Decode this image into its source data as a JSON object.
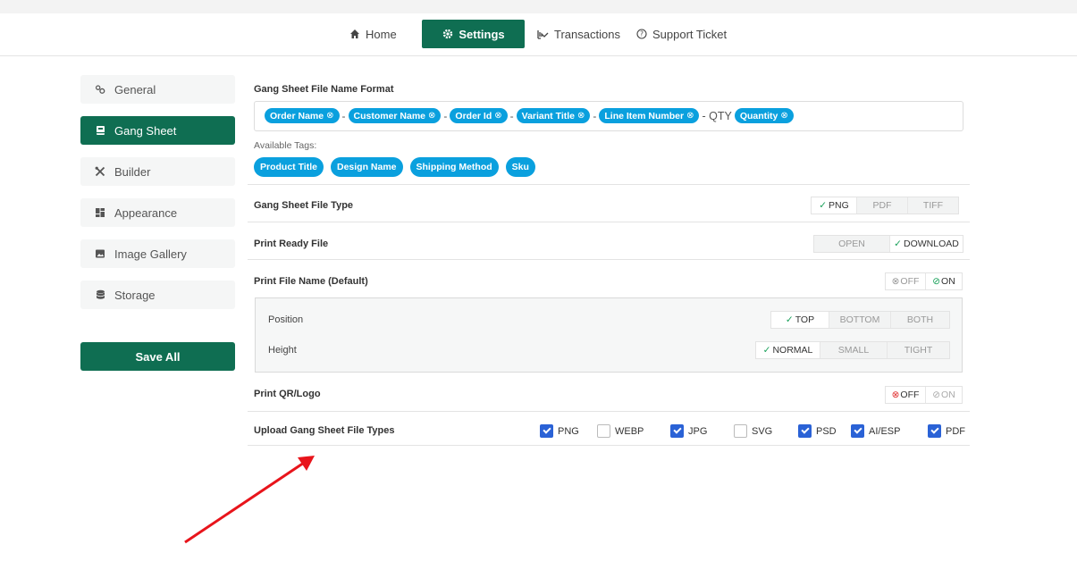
{
  "nav": {
    "home": "Home",
    "settings": "Settings",
    "transactions": "Transactions",
    "support": "Support Ticket"
  },
  "sidebar": {
    "items": [
      {
        "label": "General",
        "icon": "gears-icon"
      },
      {
        "label": "Gang Sheet",
        "icon": "book-icon"
      },
      {
        "label": "Builder",
        "icon": "tools-icon"
      },
      {
        "label": "Appearance",
        "icon": "layout-icon"
      },
      {
        "label": "Image Gallery",
        "icon": "image-icon"
      },
      {
        "label": "Storage",
        "icon": "database-icon"
      }
    ],
    "save_label": "Save All"
  },
  "format": {
    "label": "Gang Sheet File Name Format",
    "tags": [
      "Order Name",
      "Customer Name",
      "Order Id",
      "Variant Title",
      "Line Item Number",
      "Quantity"
    ],
    "separator": "-",
    "qty_text": "- QTY",
    "available_label": "Available Tags:",
    "available_tags": [
      "Product Title",
      "Design Name",
      "Shipping Method",
      "Sku"
    ]
  },
  "file_type": {
    "label": "Gang Sheet File Type",
    "options": [
      "PNG",
      "PDF",
      "TIFF"
    ],
    "selected": "PNG"
  },
  "print_ready": {
    "label": "Print Ready File",
    "options": [
      "OPEN",
      "DOWNLOAD"
    ],
    "selected": "DOWNLOAD"
  },
  "print_file_name": {
    "label": "Print File Name (Default)",
    "off": "OFF",
    "on": "ON",
    "state": "ON",
    "position": {
      "label": "Position",
      "options": [
        "TOP",
        "BOTTOM",
        "BOTH"
      ],
      "selected": "TOP"
    },
    "height": {
      "label": "Height",
      "options": [
        "NORMAL",
        "SMALL",
        "TIGHT"
      ],
      "selected": "NORMAL"
    }
  },
  "print_qr": {
    "label": "Print QR/Logo",
    "off": "OFF",
    "on": "ON",
    "state": "OFF"
  },
  "upload_types": {
    "label": "Upload Gang Sheet File Types",
    "items": [
      {
        "label": "PNG",
        "checked": true
      },
      {
        "label": "WEBP",
        "checked": false
      },
      {
        "label": "JPG",
        "checked": true
      },
      {
        "label": "SVG",
        "checked": false
      },
      {
        "label": "PSD",
        "checked": true
      },
      {
        "label": "AI/ESP",
        "checked": true
      },
      {
        "label": "PDF",
        "checked": true
      }
    ]
  },
  "colors": {
    "primary": "#0f6e52",
    "tag": "#0aa0de",
    "checkbox": "#2a62d6",
    "annotation_arrow": "#e8141b"
  }
}
